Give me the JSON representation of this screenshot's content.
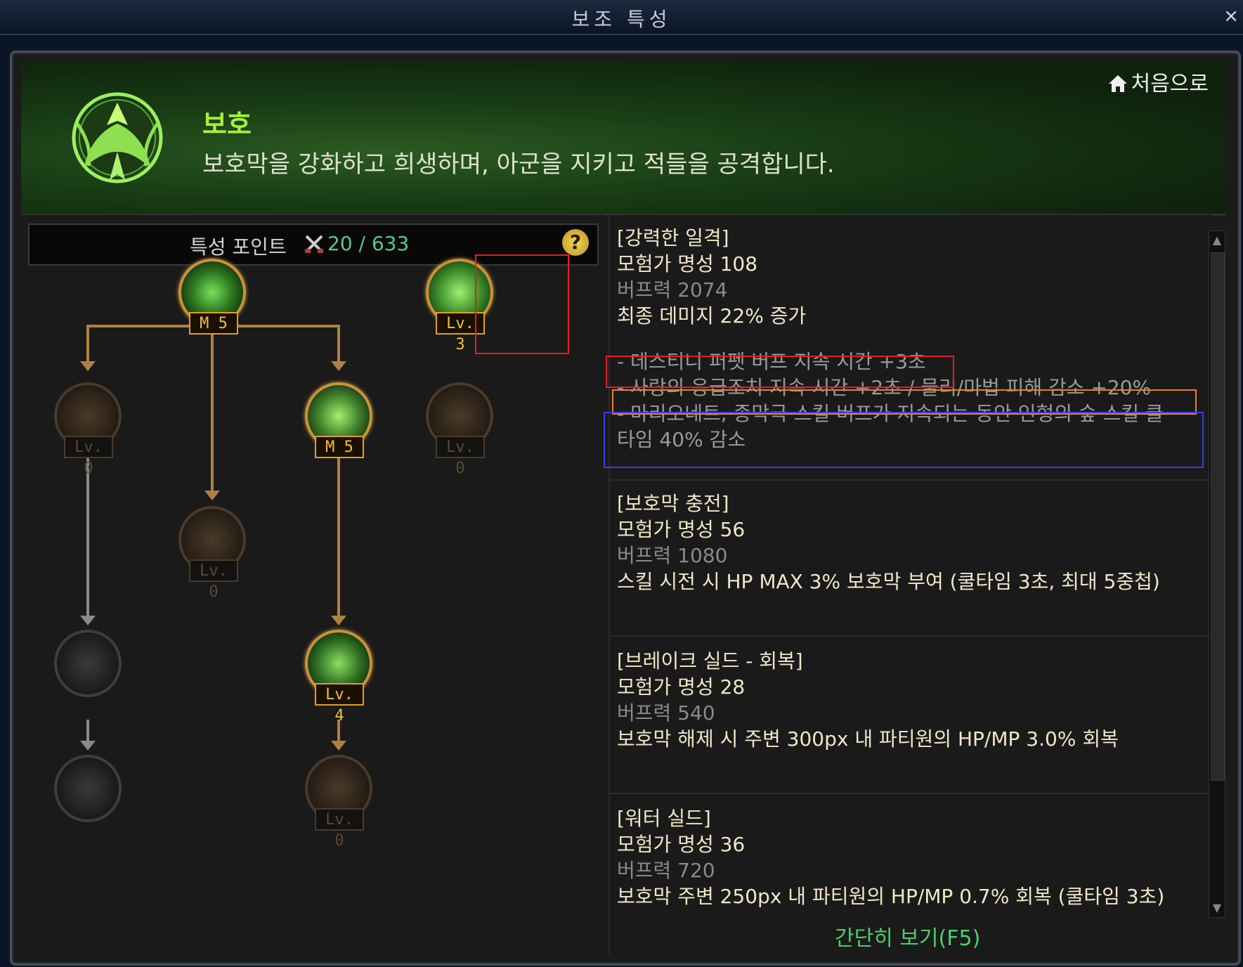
{
  "window": {
    "title": "보조 특성",
    "close": "×"
  },
  "header": {
    "category": "보호",
    "description": "보호막을 강화하고 희생하며, 아군을 지키고 적들을 공격합니다.",
    "home_label": "처음으로"
  },
  "points": {
    "label": "특성 포인트",
    "value": "20 / 633",
    "help": "?"
  },
  "tree": {
    "nodes": [
      {
        "id": "n1",
        "badge": "M 5",
        "state": "active"
      },
      {
        "id": "n2",
        "badge": "Lv. 3",
        "state": "active"
      },
      {
        "id": "n3",
        "badge": "Lv. 0",
        "state": "inactive"
      },
      {
        "id": "n4",
        "badge": "M 5",
        "state": "active"
      },
      {
        "id": "n5",
        "badge": "Lv. 0",
        "state": "inactive"
      },
      {
        "id": "n6",
        "badge": "Lv. 0",
        "state": "inactive"
      },
      {
        "id": "n7",
        "badge": "",
        "state": "locked"
      },
      {
        "id": "n8",
        "badge": "Lv. 4",
        "state": "active"
      },
      {
        "id": "n9",
        "badge": "",
        "state": "locked"
      },
      {
        "id": "n10",
        "badge": "Lv. 0",
        "state": "inactive"
      }
    ]
  },
  "details": [
    {
      "name": "[강력한 일격]",
      "fame": "모험가 명성 108",
      "buff": "버프력 2074",
      "effect": "최종 데미지 22% 증가",
      "subs": [
        "- 데스티니 퍼펫 버프 지속 시간 +3초",
        "- 사랑의 응급조치 지속 시간 +2초 / 물리/마법 피해 감소 +20%",
        "- 마리오네트, 종막극 스킬 버프가 지속되는 동안 인형의 숲 스킬 쿨",
        "타임 40% 감소"
      ]
    },
    {
      "name": "[보호막 충전]",
      "fame": "모험가 명성 56",
      "buff": "버프력 1080",
      "effect": "스킬 시전 시 HP MAX 3% 보호막 부여 (쿨타임 3초, 최대 5중첩)"
    },
    {
      "name": "[브레이크 실드 - 회복]",
      "fame": "모험가 명성 28",
      "buff": "버프력 540",
      "effect": "보호막 해제 시 주변 300px 내 파티원의 HP/MP 3.0% 회복"
    },
    {
      "name": "[워터 실드]",
      "fame": "모험가 명성 36",
      "buff": "버프력 720",
      "effect": "보호막 주변 250px 내 파티원의 HP/MP 0.7% 회복 (쿨타임 3초)"
    }
  ],
  "footer": {
    "simple_view": "간단히 보기(F5)"
  },
  "colors": {
    "accent_green": "#a6f03c",
    "badge_gold": "#e0a020",
    "highlight_red": "#e02020",
    "highlight_orange": "#f08020",
    "highlight_blue": "#3040e0"
  }
}
